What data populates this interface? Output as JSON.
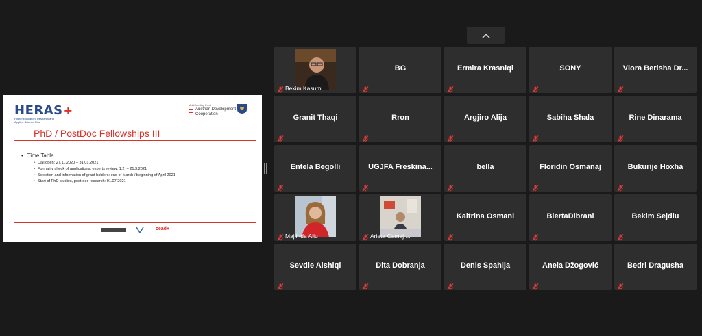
{
  "slide": {
    "logo": "HERAS",
    "logo_tag": "Higher Education, Research and Applied Science Plus",
    "funded_by": "Multi-funding Fund",
    "partner": "Austrian Development Cooperation",
    "title": "PhD / PostDoc Fellowships III",
    "section": "Time Table",
    "items": [
      "Call open: 27.11.2020 – 31.01.2021",
      "Formality check of applications, experts review: 1.2. – 21.3.2021",
      "Selection and information of grant holders: end of March / beginning of April 2021",
      "Start of PhD studies, post-doc research: 01.07.2021"
    ],
    "footer_logo": "cead"
  },
  "participants": [
    {
      "name": "Bekim Kasumi",
      "video": true,
      "avatar": "man-with-glasses"
    },
    {
      "name": "BG"
    },
    {
      "name": "Ermira Krasniqi"
    },
    {
      "name": "SONY"
    },
    {
      "name": "Vlora Berisha Dr..."
    },
    {
      "name": "Granit Thaqi"
    },
    {
      "name": "Rron"
    },
    {
      "name": "Argjiro Alija"
    },
    {
      "name": "Sabiha Shala"
    },
    {
      "name": "Rine Dinarama"
    },
    {
      "name": "Entela Begolli"
    },
    {
      "name": "UGJFA  Freskina..."
    },
    {
      "name": "bella"
    },
    {
      "name": "Floridin Osmanaj"
    },
    {
      "name": "Bukurije Hoxha"
    },
    {
      "name": "Majlinda Aliu",
      "video": true,
      "avatar": "woman-red-scarf"
    },
    {
      "name": "Arieta Camaj ...",
      "video": true,
      "avatar": "woman-office"
    },
    {
      "name": "Kaltrina Osmani"
    },
    {
      "name": "BlertaDibrani"
    },
    {
      "name": "Bekim Sejdiu"
    },
    {
      "name": "Sevdie Alshiqi"
    },
    {
      "name": "Dita Dobranja"
    },
    {
      "name": "Denis Spahija"
    },
    {
      "name": "Anela Džogović"
    },
    {
      "name": "Bedri Dragusha"
    }
  ],
  "icons": {
    "mic": "muted-mic-icon",
    "collapse": "chevron-up-icon",
    "splitter": "splitter-handle-icon"
  },
  "colors": {
    "background": "#1a1a1a",
    "tile": "#2e2e2e",
    "muted": "#e03a3a",
    "slide_accent": "#d9322a"
  }
}
